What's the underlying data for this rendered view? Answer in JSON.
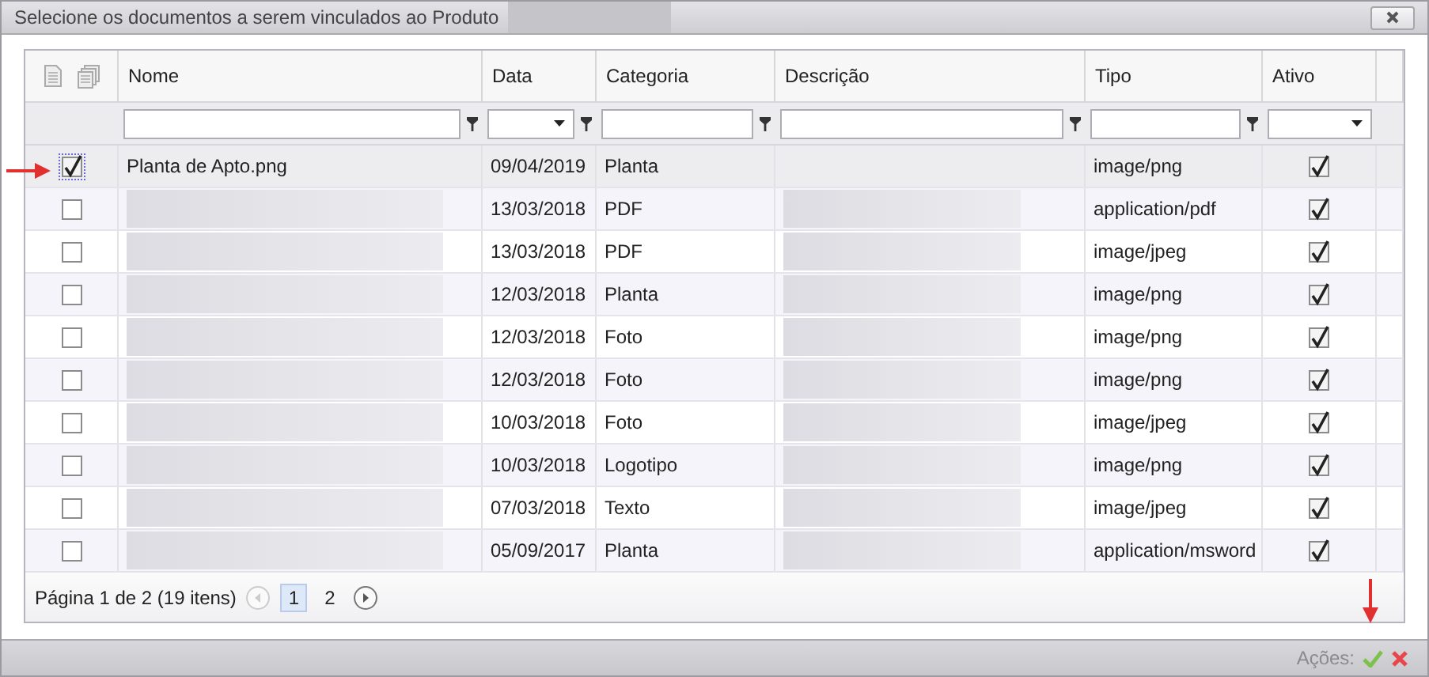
{
  "window": {
    "title": "Selecione os documentos a serem vinculados ao Produto",
    "title_redacted": true
  },
  "table": {
    "columns": [
      {
        "label": "Nome"
      },
      {
        "label": "Data"
      },
      {
        "label": "Categoria"
      },
      {
        "label": "Descrição"
      },
      {
        "label": "Tipo"
      },
      {
        "label": "Ativo"
      }
    ],
    "filters": [
      {
        "kind": "text",
        "funnel": true
      },
      {
        "kind": "select",
        "funnel": true
      },
      {
        "kind": "text",
        "funnel": true
      },
      {
        "kind": "text",
        "funnel": true
      },
      {
        "kind": "text",
        "funnel": true
      },
      {
        "kind": "select",
        "funnel": false
      }
    ],
    "rows": [
      {
        "selected": true,
        "checked": true,
        "name": "Planta de Apto.png",
        "name_redacted": false,
        "date": "09/04/2019",
        "category": "Planta",
        "description_redacted": false,
        "type": "image/png",
        "active": true
      },
      {
        "selected": false,
        "checked": false,
        "name_redacted": true,
        "date": "13/03/2018",
        "category": "PDF",
        "description_redacted": true,
        "type": "application/pdf",
        "active": true
      },
      {
        "selected": false,
        "checked": false,
        "name_redacted": true,
        "date": "13/03/2018",
        "category": "PDF",
        "description_redacted": true,
        "type": "image/jpeg",
        "active": true
      },
      {
        "selected": false,
        "checked": false,
        "name_redacted": true,
        "date": "12/03/2018",
        "category": "Planta",
        "description_redacted": true,
        "type": "image/png",
        "active": true
      },
      {
        "selected": false,
        "checked": false,
        "name_redacted": true,
        "date": "12/03/2018",
        "category": "Foto",
        "description_redacted": true,
        "type": "image/png",
        "active": true
      },
      {
        "selected": false,
        "checked": false,
        "name_redacted": true,
        "date": "12/03/2018",
        "category": "Foto",
        "description_redacted": true,
        "type": "image/png",
        "active": true
      },
      {
        "selected": false,
        "checked": false,
        "name_redacted": true,
        "date": "10/03/2018",
        "category": "Foto",
        "description_redacted": true,
        "type": "image/jpeg",
        "active": true
      },
      {
        "selected": false,
        "checked": false,
        "name_redacted": true,
        "date": "10/03/2018",
        "category": "Logotipo",
        "description_redacted": true,
        "type": "image/png",
        "active": true
      },
      {
        "selected": false,
        "checked": false,
        "name_redacted": true,
        "date": "07/03/2018",
        "category": "Texto",
        "description_redacted": true,
        "type": "image/jpeg",
        "active": true
      },
      {
        "selected": false,
        "checked": false,
        "name_redacted": true,
        "date": "05/09/2017",
        "category": "Planta",
        "description_redacted": true,
        "type": "application/msword",
        "active": true
      }
    ]
  },
  "pager": {
    "summary": "Página 1 de 2 (19 itens)",
    "prev_disabled": true,
    "pages": [
      {
        "label": "1",
        "selected": true
      },
      {
        "label": "2",
        "selected": false
      }
    ]
  },
  "footer": {
    "label": "Ações:"
  }
}
